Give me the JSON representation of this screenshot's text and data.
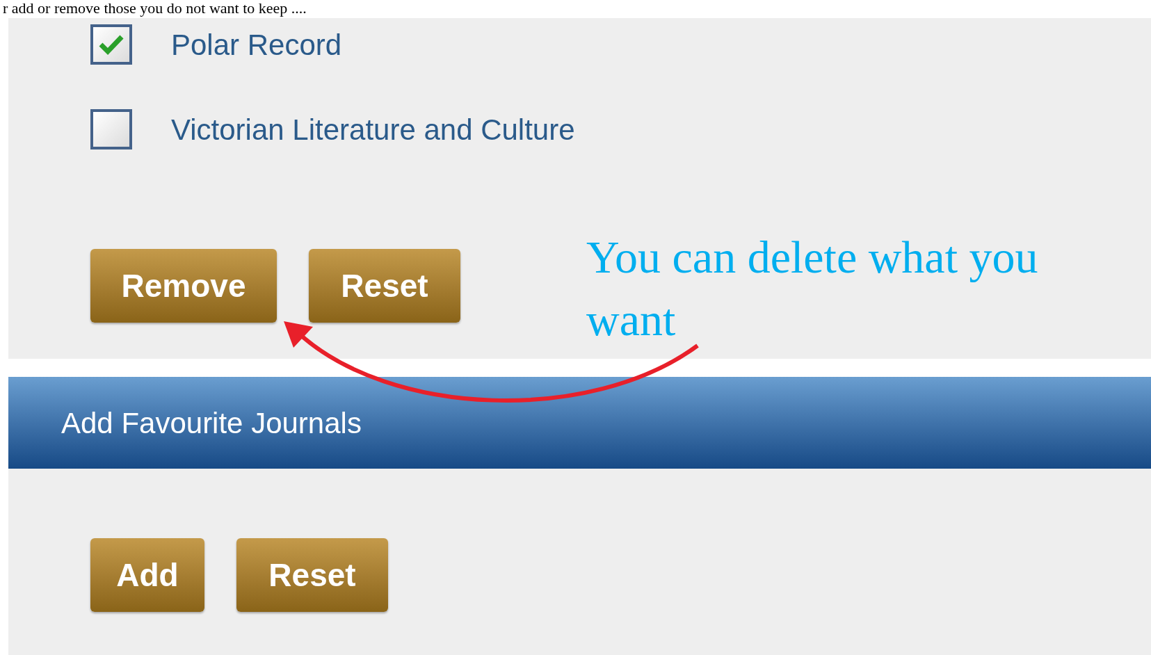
{
  "caption": "r add or remove those you do not want to keep ....",
  "journals": [
    {
      "label": "Polar Record",
      "checked": true
    },
    {
      "label": "Victorian Literature and Culture",
      "checked": false
    }
  ],
  "favourites_buttons": [
    "Remove",
    "Reset"
  ],
  "add_section": {
    "title": "Add Favourite Journals",
    "buttons": [
      "Add",
      "Reset"
    ]
  },
  "annotation": "You can delete what you want"
}
